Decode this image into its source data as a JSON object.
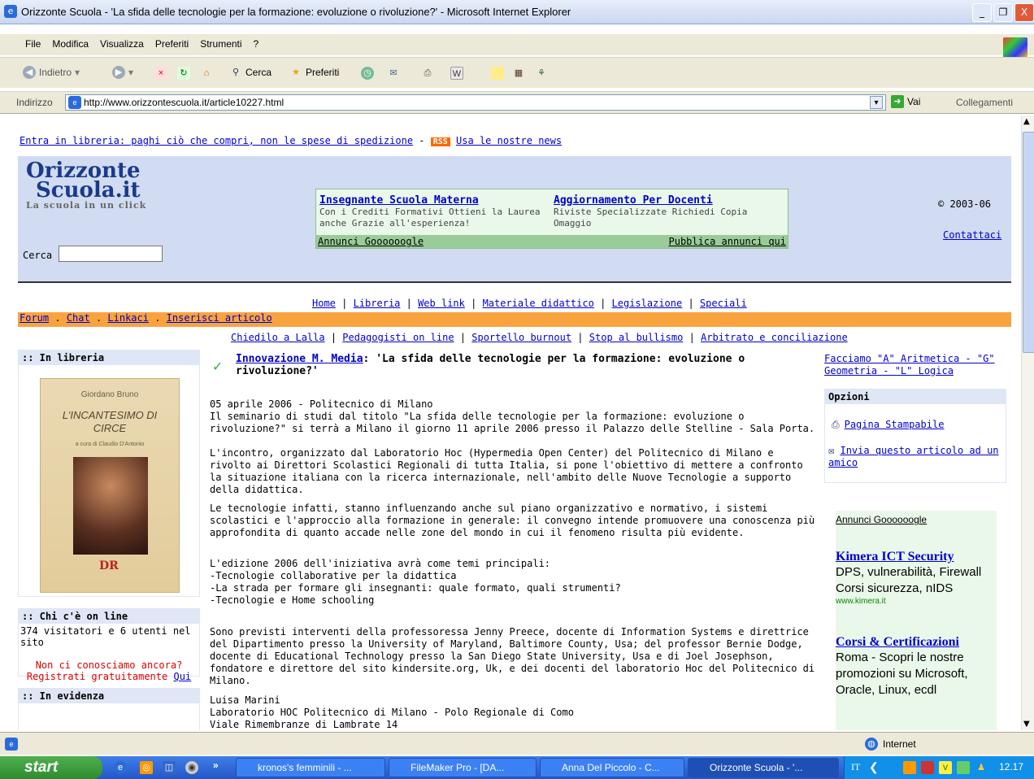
{
  "window": {
    "title": "Orizzonte Scuola - 'La sfida delle tecnologie per la formazione: evoluzione o rivoluzione?' - Microsoft Internet Explorer",
    "minimize": "_",
    "maximize": "❐",
    "close": "X"
  },
  "menu": [
    "File",
    "Modifica",
    "Visualizza",
    "Preferiti",
    "Strumenti",
    "?"
  ],
  "toolbar": {
    "back": "Indietro",
    "search": "Cerca",
    "favorites": "Preferiti"
  },
  "address": {
    "label": "Indirizzo",
    "url": "http://www.orizzontescuola.it/article10227.html",
    "go": "Vai",
    "links": "Collegamenti"
  },
  "page": {
    "promo_text": "Entra in libreria: paghi ciò che compri, non le spese di spedizione",
    "promo_sep": " - ",
    "rss_badge": "RSS",
    "rss_link": "Usa le nostre news",
    "logo_line1": "Orizzonte",
    "logo_line2": "Scuola.it",
    "logo_tagline": "La scuola in un click",
    "search_label": "Cerca",
    "copyright": "© 2003-06",
    "contact": "Contattaci",
    "ads": {
      "ad1_title": "Insegnante Scuola Materna",
      "ad1_text": "Con i Crediti Formativi Ottieni la Laurea anche Grazie all'esperienza!",
      "ad2_title": "Aggiornamento Per Docenti",
      "ad2_text": "Riviste Specializzate Richiedi Copia Omaggio",
      "footer_left": "Annunci Goooooogle",
      "footer_right": "Pubblica annunci qui"
    },
    "nav1": [
      "Home",
      "Libreria",
      "Web link",
      "Materiale didattico",
      "Legislazione",
      "Speciali"
    ],
    "nav2": [
      "Forum",
      "Chat",
      "Linkaci",
      "Inserisci articolo"
    ],
    "nav3": [
      "Chiedilo a Lalla",
      "Pedagogisti on line",
      "Sportello burnout",
      "Stop al bullismo",
      "Arbitrato e conciliazione"
    ],
    "left": {
      "libreria_title": ":: In libreria",
      "book_author": "Giordano Bruno",
      "book_title": "L'INCANTESIMO DI CIRCE",
      "book_editor": "a cura di Claudio D'Antonio",
      "book_publisher": "DR",
      "online_title": ":: Chi c'è on line",
      "online_count": "374 visitatori e 6 utenti nel sito",
      "online_msg1": "Non ci conosciamo ancora?",
      "online_msg2": "Registrati gratuitamente",
      "online_link": "Qui",
      "evidenza_title": ":: In evidenza"
    },
    "article": {
      "category": "Innovazione M. Media",
      "title": ": 'La sfida delle tecnologie per la formazione: evoluzione o rivoluzione?'",
      "p1": "05 aprile 2006 - Politecnico di Milano\nIl seminario di studi dal titolo \"La sfida delle tecnologie per la formazione: evoluzione o rivoluzione?\" si terrà a Milano il giorno 11 aprile 2006 presso il Palazzo delle Stelline - Sala Porta.",
      "p2": "L'incontro, organizzato dal Laboratorio Hoc (Hypermedia Open Center) del Politecnico di Milano e rivolto ai Direttori Scolastici Regionali di tutta Italia, si pone l'obiettivo di mettere a confronto la situazione italiana con la ricerca internazionale, nell'ambito delle Nuove Tecnologie a supporto della didattica.",
      "p3": "Le tecnologie infatti, stanno influenzando anche sul piano organizzativo e normativo, i sistemi scolastici e l'approccio alla formazione in generale: il convegno intende promuovere una conoscenza più approfondita di quanto accade nelle zone del mondo in cui il fenomeno risulta più evidente.",
      "p4": "L'edizione 2006 dell'iniziativa avrà come temi principali:\n-Tecnologie collaborative per la didattica\n-La strada per formare gli insegnanti: quale formato, quali strumenti?\n-Tecnologie e Home schooling",
      "p5": "Sono previsti interventi della professoressa Jenny Preece, docente di Information Systems e direttrice del Dipartimento presso la University of Maryland, Baltimore County, Usa; del professor Bernie Dodge, docente di Educational Technology presso la San Diego State University, Usa e di Joel Josephson, fondatore e direttore del sito kindersite.org, Uk, e dei docenti del laboratorio Hoc del Politecnico di Milano.",
      "p6": "Luisa Marini\nLaboratorio HOC Politecnico di Milano - Polo Regionale di Como\nViale Rimembranze di Lambrate 14"
    },
    "right": {
      "top_link": "Facciamo \"A\" Aritmetica - \"G\" Geometria - \"L\" Logica",
      "options_title": "Opzioni",
      "print_link": "Pagina Stampabile",
      "send_link": "Invia questo articolo ad un amico",
      "ads_header": "Annunci Goooooogle",
      "ad1_title": "Kimera ICT Security",
      "ad1_text": "DPS, vulnerabilità, Firewall Corsi sicurezza, nIDS",
      "ad1_url": "www.kimera.it",
      "ad2_title": "Corsi & Certificazioni",
      "ad2_text": "Roma - Scopri le nostre promozioni su Microsoft, Oracle, Linux, ecdl"
    }
  },
  "status": {
    "zone": "Internet"
  },
  "taskbar": {
    "start": "start",
    "tasks": [
      "kronos's femminili - ...",
      "FileMaker Pro - [DA...",
      "Anna Del Piccolo - C...",
      "Orizzonte Scuola - '..."
    ],
    "lang": "IT",
    "clock": "12.17"
  },
  "colors": {
    "header_bg": "#d1dbf1",
    "nav_orange": "#f9a33e",
    "ad_green": "#eaf8ea",
    "link": "#0000cc"
  }
}
